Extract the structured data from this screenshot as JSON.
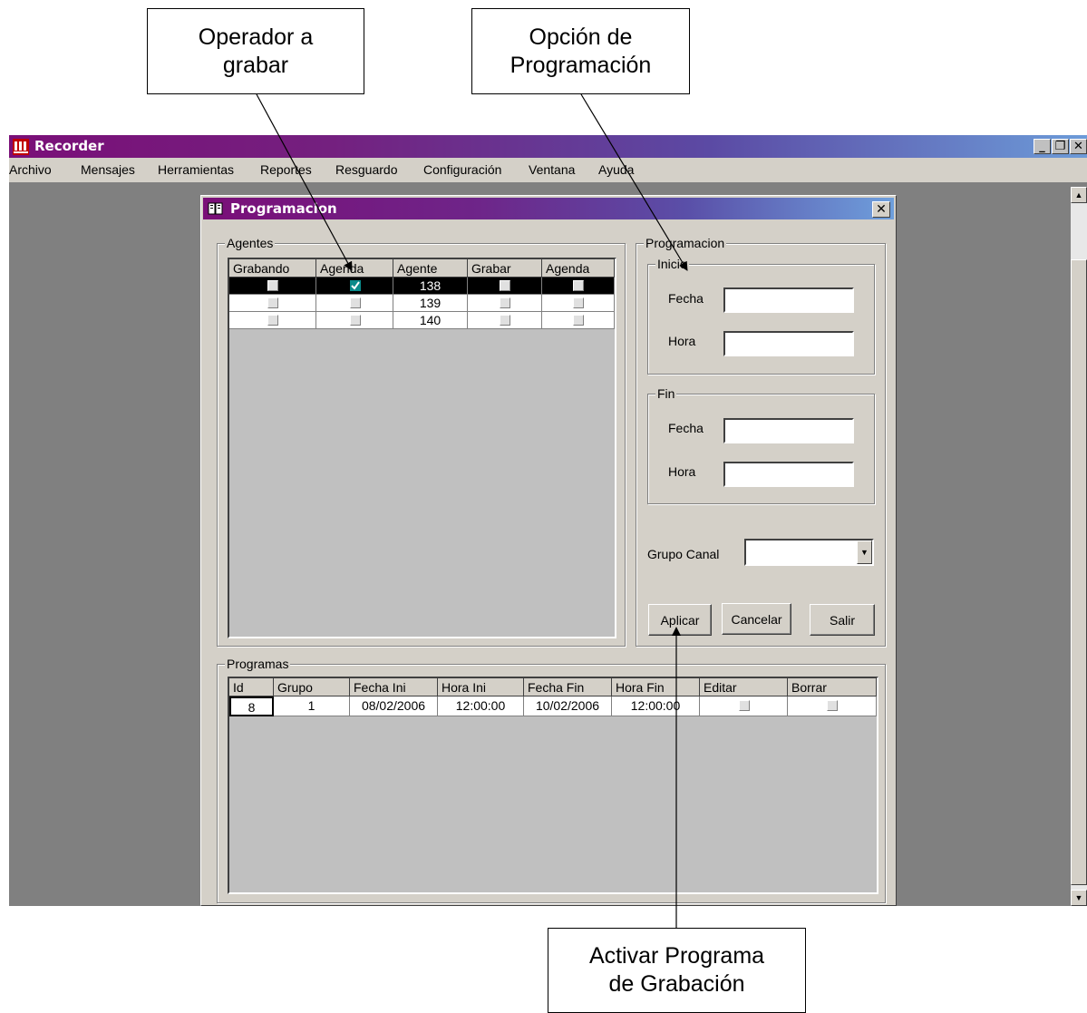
{
  "callouts": {
    "operador": "Operador a\ngrabar",
    "opcion": "Opción de\nProgramación",
    "activar": "Activar Programa\nde Grabación"
  },
  "app": {
    "title": "Recorder",
    "menu": [
      "Archivo",
      "Mensajes",
      "Herramientas",
      "Reportes",
      "Resguardo",
      "Configuración",
      "Ventana",
      "Ayuda"
    ]
  },
  "dialog": {
    "title": "Programacion",
    "agentes": {
      "label": "Agentes",
      "headers": [
        "Grabando",
        "Agenda",
        "Agente",
        "Grabar",
        "Agenda"
      ],
      "rows": [
        {
          "grabando": false,
          "agenda": true,
          "agente": "138",
          "grabar": false,
          "agenda2": false,
          "selected": true
        },
        {
          "grabando": false,
          "agenda": false,
          "agente": "139",
          "grabar": false,
          "agenda2": false,
          "selected": false
        },
        {
          "grabando": false,
          "agenda": false,
          "agente": "140",
          "grabar": false,
          "agenda2": false,
          "selected": false
        }
      ]
    },
    "programacion": {
      "label": "Programacion",
      "inicio": {
        "label": "Inicio",
        "fecha_label": "Fecha",
        "hora_label": "Hora",
        "fecha_value": "",
        "hora_value": ""
      },
      "fin": {
        "label": "Fin",
        "fecha_label": "Fecha",
        "hora_label": "Hora",
        "fecha_value": "",
        "hora_value": ""
      },
      "grupo_canal_label": "Grupo Canal",
      "grupo_canal_value": ""
    },
    "buttons": {
      "aplicar": "Aplicar",
      "cancelar": "Cancelar",
      "salir": "Salir"
    },
    "programas": {
      "label": "Programas",
      "headers": [
        "Id",
        "Grupo",
        "Fecha Ini",
        "Hora Ini",
        "Fecha Fin",
        "Hora Fin",
        "Editar",
        "Borrar"
      ],
      "rows": [
        {
          "id": "8",
          "grupo": "1",
          "fecha_ini": "08/02/2006",
          "hora_ini": "12:00:00",
          "fecha_fin": "10/02/2006",
          "hora_fin": "12:00:00",
          "editar": false,
          "borrar": false
        }
      ]
    }
  }
}
